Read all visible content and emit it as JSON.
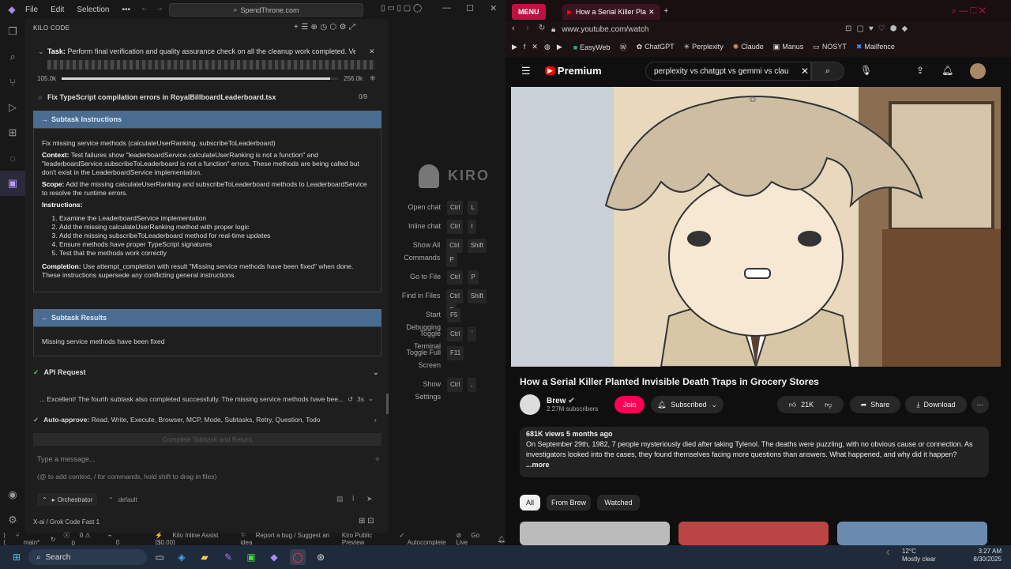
{
  "vscode": {
    "menu": [
      "File",
      "Edit",
      "Selection"
    ],
    "search": "SpendThrone.com",
    "more": "•••"
  },
  "kilo": {
    "header": "KILO CODE",
    "task_label": "Task:",
    "task_text": "Perform final verification and quality assurance check on all the cleanup work completed. Verify t...",
    "tokens_left": "105.0k",
    "tokens_right": "256.0k",
    "todo": "Fix TypeScript compilation errors in RoyalBillboardLeaderboard.tsx",
    "todo_count": "0/9",
    "sub_instructions_title": "Subtask Instructions",
    "instr_line1": "Fix missing service methods (calculateUserRanking, subscribeToLeaderboard)",
    "context_label": "Context:",
    "context_text": "Test failures show \"leaderboardService.calculateUserRanking is not a function\" and \"leaderboardService.subscribeToLeaderboard is not a function\" errors. These methods are being called but don't exist in the LeaderboardService implementation.",
    "scope_label": "Scope:",
    "scope_text": "Add the missing calculateUserRanking and subscribeToLeaderboard methods to LeaderboardService to resolve the runtime errors.",
    "instructions_label": "Instructions:",
    "steps": [
      "Examine the LeaderboardService implementation",
      "Add the missing calculateUserRanking method with proper logic",
      "Add the missing subscribeToLeaderboard method for real-time updates",
      "Ensure methods have proper TypeScript signatures",
      "Test that the methods work correctly"
    ],
    "completion_label": "Completion:",
    "completion_text": "Use attempt_completion with result \"Missing service methods have been fixed\" when done. These instructions supersede any conflicting general instructions.",
    "sub_results_title": "Subtask Results",
    "results_text": "Missing service methods have been fixed",
    "api_label": "API Request",
    "message_preview": "... Excellent! The fourth subtask also completed successfully. The missing service methods have bee...",
    "message_time": "3s",
    "auto_approve_label": "Auto-approve:",
    "auto_approve_list": "Read, Write, Execute, Browser, MCP, Mode, Subtasks, Retry, Question, Todo",
    "complete_button": "Complete Subtask and Return",
    "input_placeholder": "Type a message...",
    "input_hint": "(@ to add context, / for commands, hold shift to drag in files)",
    "mode": "Orchestrator",
    "profile": "default",
    "model": "X-ai / Grok Code Fast 1",
    "progress": 0.97
  },
  "kiro": {
    "logo": "KIRO",
    "shortcuts": [
      {
        "label": "Open chat",
        "keys": [
          "Ctrl",
          "L"
        ]
      },
      {
        "label": "Inline chat",
        "keys": [
          "Ctrl",
          "I"
        ]
      },
      {
        "label": "Show All Commands",
        "keys": [
          "Ctrl",
          "Shift",
          "P"
        ]
      },
      {
        "label": "Go to File",
        "keys": [
          "Ctrl",
          "P"
        ]
      },
      {
        "label": "Find in Files",
        "keys": [
          "Ctrl",
          "Shift",
          "F"
        ]
      },
      {
        "label": "Start Debugging",
        "keys": [
          "F5"
        ]
      },
      {
        "label": "Toggle Terminal",
        "keys": [
          "Ctrl",
          "`"
        ]
      },
      {
        "label": "Toggle Full Screen",
        "keys": [
          "F11"
        ]
      },
      {
        "label": "Show Settings",
        "keys": [
          "Ctrl",
          ","
        ]
      }
    ]
  },
  "statusbar": {
    "branch": "main*",
    "errors": "0",
    "warnings": "0",
    "ports": "0",
    "kilo": "Kilo Inline Assist ($0.00)",
    "bug": "Report a bug / Suggest an idea",
    "preview": "Kiro Public Preview",
    "autocomplete": "Autocomplete",
    "golive": "Go Live"
  },
  "browser": {
    "menu": "MENU",
    "tab_title": "How a Serial Killer Pla",
    "url": "www.youtube.com/watch",
    "bookmarks": [
      "EasyWeb",
      "ChatGPT",
      "Perplexity",
      "Claude",
      "Manus",
      "NOSYT",
      "Mailfence"
    ]
  },
  "youtube": {
    "brand": "Premium",
    "search": "perplexity vs chatgpt vs gemmi vs clau",
    "title": "How a Serial Killer Planted Invisible Death Traps in Grocery Stores",
    "channel": "Brew",
    "subs": "2.27M subscribers",
    "join": "Join",
    "subscribed": "Subscribed",
    "likes": "21K",
    "share": "Share",
    "download": "Download",
    "views": "681K views  5 months ago",
    "description": "On September 29th, 1982, 7 people mysteriously died after taking Tylenol. The deaths were puzzling, with no obvious cause or connection. As investigators looked into the cases, they found themselves facing more questions than answers. What happened, and why did it happen?",
    "more": "...more",
    "chips": [
      "All",
      "From Brew",
      "Watched"
    ]
  },
  "taskbar": {
    "search": "Search",
    "temp": "12°C",
    "weather": "Mostly clear",
    "time": "3:27 AM",
    "date": "8/30/2025"
  }
}
